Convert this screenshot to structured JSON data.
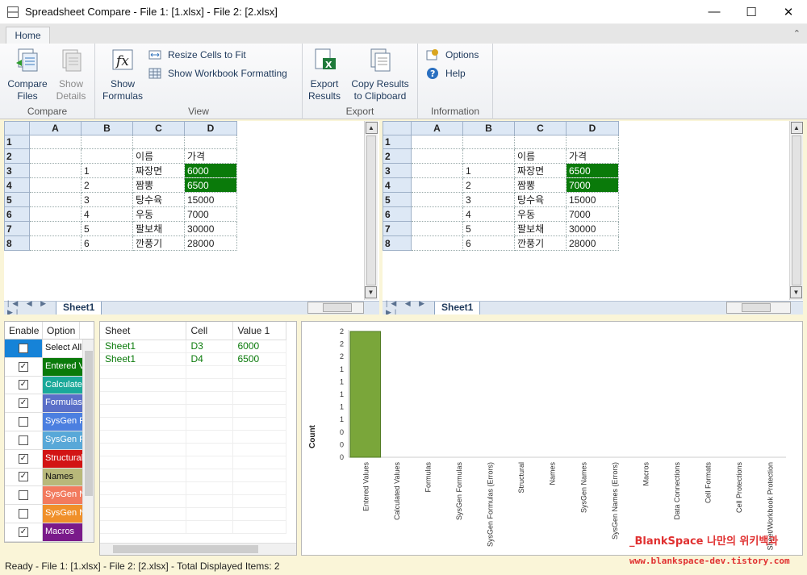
{
  "window": {
    "title": "Spreadsheet Compare - File 1: [1.xlsx] - File 2: [2.xlsx]"
  },
  "ribbon": {
    "tab": "Home",
    "groups": {
      "compare": {
        "label": "Compare",
        "compare_files": "Compare\nFiles",
        "show_details": "Show\nDetails"
      },
      "view": {
        "label": "View",
        "show_formulas": "Show\nFormulas",
        "resize_cells": "Resize Cells to Fit",
        "show_formatting": "Show Workbook Formatting"
      },
      "export": {
        "label": "Export",
        "export_results": "Export\nResults",
        "copy_results": "Copy Results\nto Clipboard"
      },
      "information": {
        "label": "Information",
        "options": "Options",
        "help": "Help"
      }
    }
  },
  "left_grid": {
    "columns": [
      "A",
      "B",
      "C",
      "D"
    ],
    "rows": [
      {
        "n": "1",
        "cells": [
          "",
          "",
          "",
          ""
        ]
      },
      {
        "n": "2",
        "cells": [
          "",
          "",
          "이름",
          "가격"
        ]
      },
      {
        "n": "3",
        "cells": [
          "",
          "1",
          "짜장면",
          "6000"
        ],
        "diff": true
      },
      {
        "n": "4",
        "cells": [
          "",
          "2",
          "짬뽕",
          "6500"
        ],
        "diff": true
      },
      {
        "n": "5",
        "cells": [
          "",
          "3",
          "탕수육",
          "15000"
        ]
      },
      {
        "n": "6",
        "cells": [
          "",
          "4",
          "우동",
          "7000"
        ]
      },
      {
        "n": "7",
        "cells": [
          "",
          "5",
          "팔보채",
          "30000"
        ]
      },
      {
        "n": "8",
        "cells": [
          "",
          "6",
          "깐풍기",
          "28000"
        ]
      }
    ],
    "sheet": "Sheet1"
  },
  "right_grid": {
    "columns": [
      "A",
      "B",
      "C",
      "D"
    ],
    "rows": [
      {
        "n": "1",
        "cells": [
          "",
          "",
          "",
          ""
        ]
      },
      {
        "n": "2",
        "cells": [
          "",
          "",
          "이름",
          "가격"
        ]
      },
      {
        "n": "3",
        "cells": [
          "",
          "1",
          "짜장면",
          "6500"
        ],
        "diff": true
      },
      {
        "n": "4",
        "cells": [
          "",
          "2",
          "짬뽕",
          "7000"
        ],
        "diff": true
      },
      {
        "n": "5",
        "cells": [
          "",
          "3",
          "탕수육",
          "15000"
        ]
      },
      {
        "n": "6",
        "cells": [
          "",
          "4",
          "우동",
          "7000"
        ]
      },
      {
        "n": "7",
        "cells": [
          "",
          "5",
          "팔보채",
          "30000"
        ]
      },
      {
        "n": "8",
        "cells": [
          "",
          "6",
          "깐풍기",
          "28000"
        ]
      }
    ],
    "sheet": "Sheet1"
  },
  "options_panel": {
    "headers": {
      "enable": "Enable",
      "option": "Option"
    },
    "items": [
      {
        "label": "Select All",
        "checked": false,
        "color": "#ffffff",
        "text_color": "#111111",
        "check_bg": "#1683d8"
      },
      {
        "label": "Entered Values",
        "checked": true,
        "color": "#0a7a0a"
      },
      {
        "label": "Calculated Values",
        "checked": true,
        "color": "#1aa99a"
      },
      {
        "label": "Formulas",
        "checked": true,
        "color": "#5a6fc8"
      },
      {
        "label": "SysGen Formulas",
        "checked": false,
        "color": "#4b7fe0"
      },
      {
        "label": "SysGen Formulas (Errors)",
        "checked": false,
        "color": "#58a8d8"
      },
      {
        "label": "Structural",
        "checked": true,
        "color": "#d21414"
      },
      {
        "label": "Names",
        "checked": true,
        "color": "#b8b87a",
        "text_color": "#111111"
      },
      {
        "label": "SysGen Names",
        "checked": false,
        "color": "#f27a5e"
      },
      {
        "label": "SysGen Names (Errors)",
        "checked": false,
        "color": "#f0902a"
      },
      {
        "label": "Macros",
        "checked": true,
        "color": "#7a1a8a"
      }
    ]
  },
  "results": {
    "headers": [
      "Sheet",
      "Cell",
      "Value 1"
    ],
    "rows": [
      [
        "Sheet1",
        "D3",
        "6000"
      ],
      [
        "Sheet1",
        "D4",
        "6500"
      ]
    ]
  },
  "chart_data": {
    "type": "bar",
    "ylabel": "Count",
    "y_tick_labels": [
      "2",
      "2",
      "2",
      "1",
      "1",
      "1",
      "1",
      "1",
      "0",
      "0",
      "0"
    ],
    "categories": [
      "Entered Values",
      "Calculated Values",
      "Formulas",
      "SysGen Formulas",
      "SysGen Formulas (Errors)",
      "Structural",
      "Names",
      "SysGen Names",
      "SysGen Names (Errors)",
      "Macros",
      "Data Connections",
      "Cell Formats",
      "Cell Protections",
      "Sheet/Workbook Protection"
    ],
    "values": [
      2,
      0,
      0,
      0,
      0,
      0,
      0,
      0,
      0,
      0,
      0,
      0,
      0,
      0
    ],
    "bar_color": "#7aa63a",
    "ylim": [
      0,
      2
    ]
  },
  "watermark": {
    "line1": "_BlankSpace 나만의 위키백과",
    "line2": "www.blankspace-dev.tistory.com"
  },
  "status": "Ready - File 1: [1.xlsx] - File 2: [2.xlsx] - Total Displayed Items: 2"
}
